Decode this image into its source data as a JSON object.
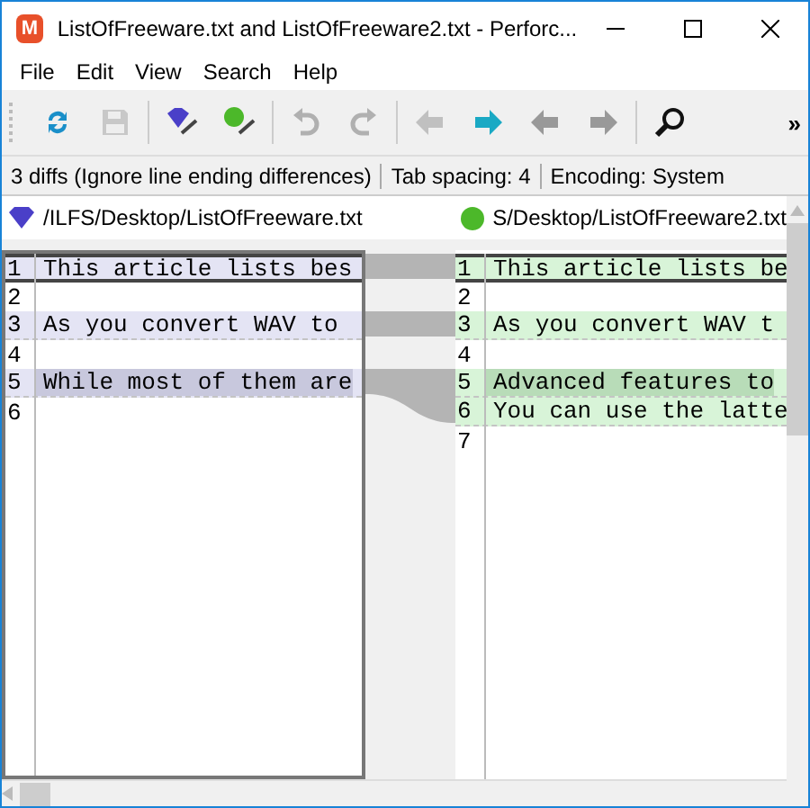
{
  "window": {
    "title": "ListOfFreeware.txt and ListOfFreeware2.txt - Perforc...",
    "logo_letter": "M"
  },
  "menu": [
    "File",
    "Edit",
    "View",
    "Search",
    "Help"
  ],
  "toolbar": [
    {
      "kind": "refresh",
      "disabled": false
    },
    {
      "kind": "save",
      "disabled": true
    },
    {
      "kind": "sep"
    },
    {
      "kind": "left-pen",
      "disabled": false
    },
    {
      "kind": "right-pen",
      "disabled": false
    },
    {
      "kind": "sep"
    },
    {
      "kind": "undo",
      "disabled": true
    },
    {
      "kind": "redo",
      "disabled": true
    },
    {
      "kind": "sep"
    },
    {
      "kind": "prev-diff",
      "disabled": true
    },
    {
      "kind": "next-diff",
      "disabled": false
    },
    {
      "kind": "prev-change",
      "disabled": true
    },
    {
      "kind": "next-change",
      "disabled": true
    },
    {
      "kind": "sep"
    },
    {
      "kind": "search",
      "disabled": false
    }
  ],
  "toolbar_overflow": "»",
  "status_bar": [
    "3 diffs (Ignore line ending differences)",
    "Tab spacing: 4",
    "Encoding: System"
  ],
  "left": {
    "path": "/ILFS/Desktop/ListOfFreeware.txt",
    "lines": [
      {
        "number": "1",
        "text": "This article lists bes",
        "changed": true,
        "emphasis": false,
        "current": true
      },
      {
        "number": "2",
        "changed": false,
        "current": false
      },
      {
        "number": "3",
        "text": "As you convert WAV to",
        "changed": true,
        "emphasis": false,
        "current": false
      },
      {
        "number": "4",
        "changed": false,
        "current": false
      },
      {
        "number": "5",
        "text": "While most of them are",
        "changed": true,
        "emphasis": true,
        "current": false
      },
      {
        "number": "6",
        "changed": false,
        "current": false
      }
    ]
  },
  "right": {
    "path": "S/Desktop/ListOfFreeware2.txt",
    "lines": [
      {
        "number": "1",
        "text": "This article lists be",
        "changed": true,
        "emphasis": false,
        "current": true
      },
      {
        "number": "2",
        "changed": false,
        "current": false
      },
      {
        "number": "3",
        "text": "As you convert WAV t",
        "changed": true,
        "emphasis": false,
        "current": false
      },
      {
        "number": "4",
        "changed": false,
        "current": false
      },
      {
        "number": "5",
        "text": "Advanced features to",
        "changed": true,
        "emphasis": true,
        "current": false
      },
      {
        "number": "6",
        "text": "You can use the latte",
        "changed": true,
        "emphasis": false,
        "current": false
      },
      {
        "number": "7",
        "changed": false,
        "current": false
      }
    ]
  }
}
